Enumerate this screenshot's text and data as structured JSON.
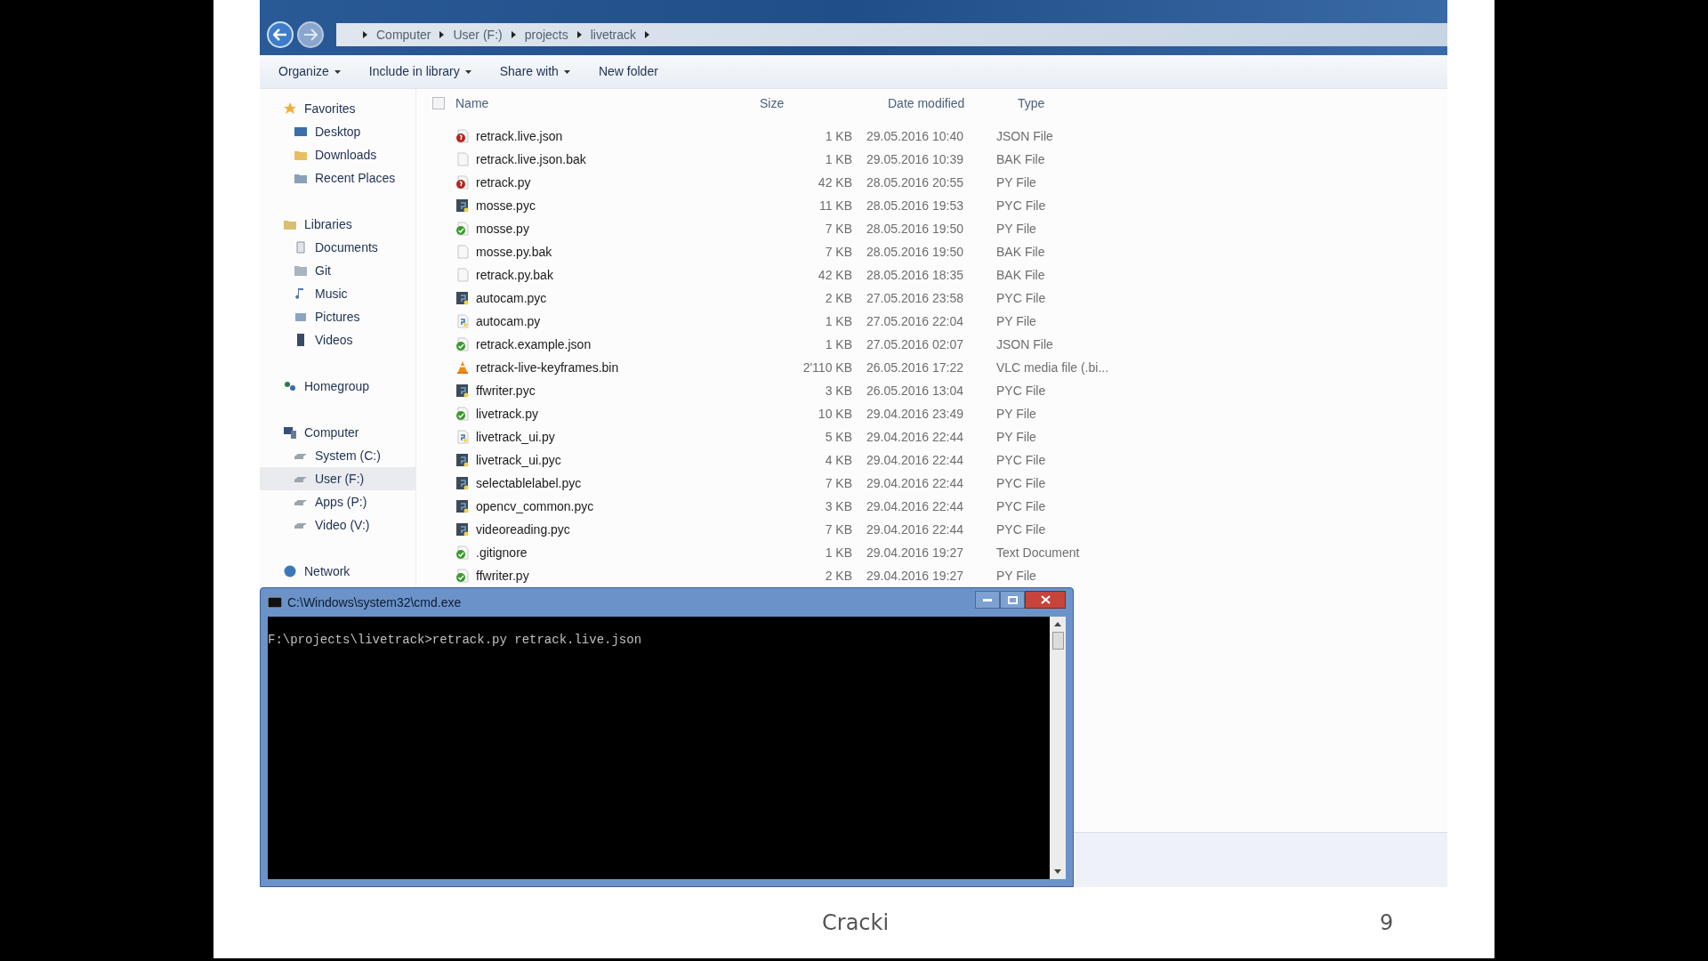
{
  "explorer": {
    "breadcrumb": [
      "Computer",
      "User (F:)",
      "projects",
      "livetrack"
    ],
    "toolbar": [
      {
        "label": "Organize",
        "dropdown": true
      },
      {
        "label": "Include in library",
        "dropdown": true
      },
      {
        "label": "Share with",
        "dropdown": true
      },
      {
        "label": "New folder",
        "dropdown": false
      }
    ],
    "sidebar": [
      {
        "label": "Favorites",
        "kind": "star",
        "selected": false,
        "children": [
          {
            "label": "Desktop",
            "kind": "desktop",
            "selected": false
          },
          {
            "label": "Downloads",
            "kind": "downloads",
            "selected": false
          },
          {
            "label": "Recent Places",
            "kind": "recent",
            "selected": false
          }
        ]
      },
      {
        "label": "Libraries",
        "kind": "library",
        "selected": false,
        "children": [
          {
            "label": "Documents",
            "kind": "document",
            "selected": false
          },
          {
            "label": "Git",
            "kind": "git",
            "selected": false
          },
          {
            "label": "Music",
            "kind": "music",
            "selected": false
          },
          {
            "label": "Pictures",
            "kind": "pictures",
            "selected": false
          },
          {
            "label": "Videos",
            "kind": "videos",
            "selected": false
          }
        ]
      },
      {
        "label": "Homegroup",
        "kind": "homegroup",
        "selected": false
      },
      {
        "label": "Computer",
        "kind": "computer",
        "selected": false,
        "children": [
          {
            "label": "System (C:)",
            "kind": "drive",
            "selected": false
          },
          {
            "label": "User (F:)",
            "kind": "drive",
            "selected": true
          },
          {
            "label": "Apps (P:)",
            "kind": "drive",
            "selected": false
          },
          {
            "label": "Video (V:)",
            "kind": "drive",
            "selected": false
          }
        ]
      },
      {
        "label": "Network",
        "kind": "network",
        "selected": false
      }
    ],
    "select_all": {
      "checked": false
    },
    "columns": [
      "Name",
      "Size",
      "Date modified",
      "Type"
    ],
    "files": [
      {
        "name": "retrack.live.json",
        "size": "1 KB",
        "date": "29.05.2016 10:40",
        "type": "JSON File",
        "kind": "red"
      },
      {
        "name": "retrack.live.json.bak",
        "size": "1 KB",
        "date": "29.05.2016 10:39",
        "type": "BAK File",
        "kind": "blank"
      },
      {
        "name": "retrack.py",
        "size": "42 KB",
        "date": "28.05.2016 20:55",
        "type": "PY File",
        "kind": "red"
      },
      {
        "name": "mosse.pyc",
        "size": "11 KB",
        "date": "28.05.2016 19:53",
        "type": "PYC File",
        "kind": "pyc"
      },
      {
        "name": "mosse.py",
        "size": "7 KB",
        "date": "28.05.2016 19:50",
        "type": "PY File",
        "kind": "green"
      },
      {
        "name": "mosse.py.bak",
        "size": "7 KB",
        "date": "28.05.2016 19:50",
        "type": "BAK File",
        "kind": "blank"
      },
      {
        "name": "retrack.py.bak",
        "size": "42 KB",
        "date": "28.05.2016 18:35",
        "type": "BAK File",
        "kind": "blank"
      },
      {
        "name": "autocam.pyc",
        "size": "2 KB",
        "date": "27.05.2016 23:58",
        "type": "PYC File",
        "kind": "pyc"
      },
      {
        "name": "autocam.py",
        "size": "1 KB",
        "date": "27.05.2016 22:04",
        "type": "PY File",
        "kind": "py"
      },
      {
        "name": "retrack.example.json",
        "size": "1 KB",
        "date": "27.05.2016 02:07",
        "type": "JSON File",
        "kind": "green"
      },
      {
        "name": "retrack-live-keyframes.bin",
        "size": "2'110 KB",
        "date": "26.05.2016 17:22",
        "type": "VLC media file (.bi...",
        "kind": "cone"
      },
      {
        "name": "ffwriter.pyc",
        "size": "3 KB",
        "date": "26.05.2016 13:04",
        "type": "PYC File",
        "kind": "pyc"
      },
      {
        "name": "livetrack.py",
        "size": "10 KB",
        "date": "29.04.2016 23:49",
        "type": "PY File",
        "kind": "green"
      },
      {
        "name": "livetrack_ui.py",
        "size": "5 KB",
        "date": "29.04.2016 22:44",
        "type": "PY File",
        "kind": "py"
      },
      {
        "name": "livetrack_ui.pyc",
        "size": "4 KB",
        "date": "29.04.2016 22:44",
        "type": "PYC File",
        "kind": "pyc"
      },
      {
        "name": "selectablelabel.pyc",
        "size": "7 KB",
        "date": "29.04.2016 22:44",
        "type": "PYC File",
        "kind": "pyc"
      },
      {
        "name": "opencv_common.pyc",
        "size": "3 KB",
        "date": "29.04.2016 22:44",
        "type": "PYC File",
        "kind": "pyc"
      },
      {
        "name": "videoreading.pyc",
        "size": "7 KB",
        "date": "29.04.2016 22:44",
        "type": "PYC File",
        "kind": "pyc"
      },
      {
        "name": ".gitignore",
        "size": "1 KB",
        "date": "29.04.2016 19:27",
        "type": "Text Document",
        "kind": "green"
      },
      {
        "name": "ffwriter.py",
        "size": "2 KB",
        "date": "29.04.2016 19:27",
        "type": "PY File",
        "kind": "green"
      }
    ]
  },
  "console": {
    "title": "C:\\Windows\\system32\\cmd.exe",
    "lines": [
      "F:\\projects\\livetrack>retrack.py retrack.live.json"
    ]
  },
  "footer": {
    "author": "Cracki",
    "page": "9"
  }
}
